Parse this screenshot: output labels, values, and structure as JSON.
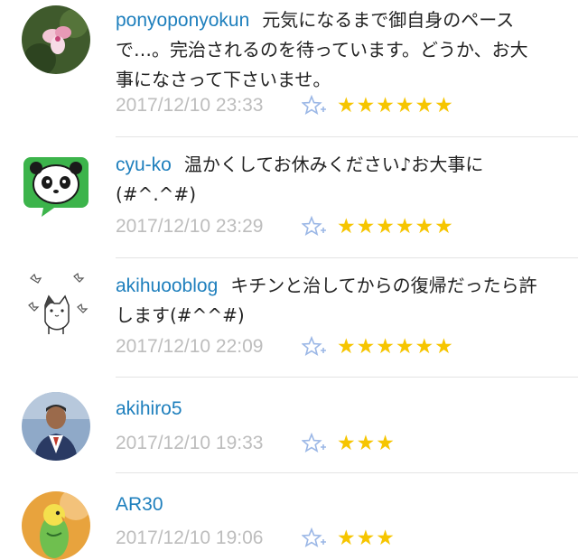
{
  "comments": [
    {
      "user": "ponyoponyokun",
      "text": "元気になるまで御自身のペースで…。完治されるのを待っています。どうか、お大事になさって下さいませ。",
      "timestamp": "2017/12/10 23:33",
      "stars": "★★★★★★",
      "star_count": 6,
      "avatar_icon": "flower-avatar-icon"
    },
    {
      "user": "cyu-ko",
      "text": "温かくしてお休みください♪お大事に(#^.^#)",
      "timestamp": "2017/12/10 23:29",
      "stars": "★★★★★★",
      "star_count": 6,
      "avatar_icon": "panda-avatar-icon"
    },
    {
      "user": "akihuooblog",
      "text": "キチンと治してからの復帰だったら許します(#^^#)",
      "timestamp": "2017/12/10 22:09",
      "stars": "★★★★★★",
      "star_count": 6,
      "avatar_icon": "cat-avatar-icon"
    },
    {
      "user": "akihiro5",
      "text": "",
      "timestamp": "2017/12/10 19:33",
      "stars": "★★★",
      "star_count": 3,
      "avatar_icon": "person-avatar-icon"
    },
    {
      "user": "AR30",
      "text": "",
      "timestamp": "2017/12/10 19:06",
      "stars": "★★★",
      "star_count": 3,
      "avatar_icon": "parakeet-avatar-icon"
    }
  ],
  "colors": {
    "username": "#1e7fbd",
    "timestamp": "#bdbdbd",
    "star": "#f6c500",
    "add_star": "#9bb7e6"
  }
}
